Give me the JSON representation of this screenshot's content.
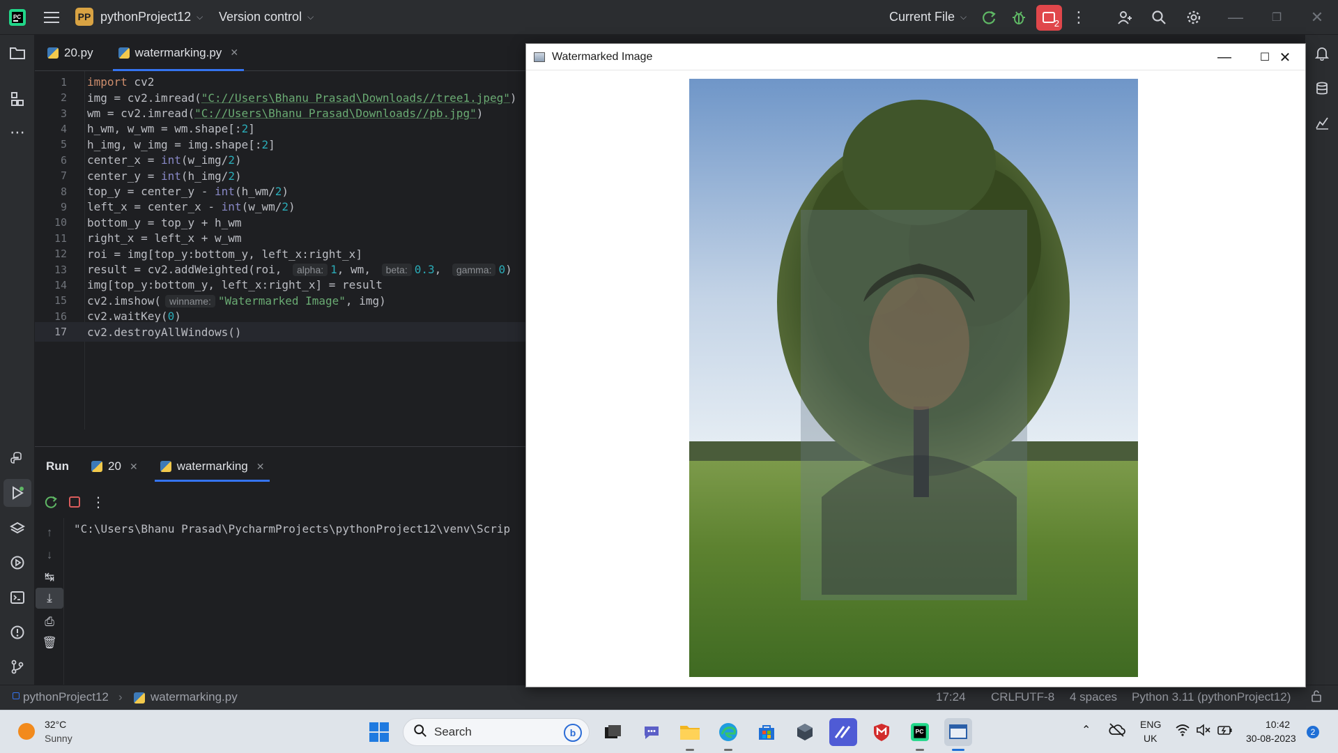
{
  "titlebar": {
    "project_badge": "PP",
    "project_name": "pythonProject12",
    "vcs_label": "Version control",
    "run_config": "Current File",
    "notification_count": "2"
  },
  "editor": {
    "tabs": [
      {
        "label": "20.py"
      },
      {
        "label": "watermarking.py"
      }
    ],
    "current_line": 17,
    "hints": {
      "alpha": "alpha:",
      "beta": "beta:",
      "gamma": "gamma:",
      "winname": "winname:"
    },
    "lines": [
      "import cv2",
      "img = cv2.imread(\"C://Users\\Bhanu Prasad\\Downloads//tree1.jpeg\")",
      "wm = cv2.imread(\"C://Users\\Bhanu Prasad\\Downloads//pb.jpg\")",
      "h_wm, w_wm = wm.shape[:2]",
      "h_img, w_img = img.shape[:2]",
      "center_x = int(w_img/2)",
      "center_y = int(h_img/2)",
      "top_y = center_y - int(h_wm/2)",
      "left_x = center_x - int(w_wm/2)",
      "bottom_y = top_y + h_wm",
      "right_x = left_x + w_wm",
      "roi = img[top_y:bottom_y, left_x:right_x]",
      "result = cv2.addWeighted(roi, 1, wm, 0.3, 0)",
      "img[top_y:bottom_y, left_x:right_x] = result",
      "cv2.imshow(\"Watermarked Image\", img)",
      "cv2.waitKey(0)",
      "cv2.destroyAllWindows()"
    ]
  },
  "run_panel": {
    "title": "Run",
    "tabs": [
      {
        "label": "20"
      },
      {
        "label": "watermarking"
      }
    ],
    "console_text": "\"C:\\Users\\Bhanu Prasad\\PycharmProjects\\pythonProject12\\venv\\Scrip"
  },
  "image_window": {
    "title": "Watermarked Image"
  },
  "statusbar": {
    "breadcrumb_project": "pythonProject12",
    "breadcrumb_file": "watermarking.py",
    "position": "17:24",
    "line_ending": "CRLF",
    "encoding": "UTF-8",
    "indent": "4 spaces",
    "interpreter": "Python 3.11 (pythonProject12)"
  },
  "taskbar": {
    "weather_temp": "32°C",
    "weather_desc": "Sunny",
    "search_placeholder": "Search",
    "lang_line1": "ENG",
    "lang_line2": "UK",
    "time": "10:42",
    "date": "30-08-2023",
    "notif_count": "2"
  },
  "colors": {
    "accent": "#3574f0",
    "ide_bg": "#1e1f22",
    "panel_bg": "#2b2d30",
    "run_green": "#5fb865",
    "stop_red": "#db5c5c",
    "notif_red": "#e0474b"
  }
}
